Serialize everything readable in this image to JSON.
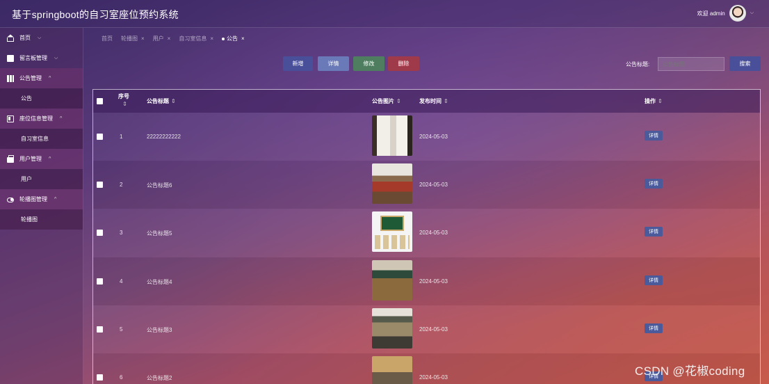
{
  "header": {
    "title": "基于springboot的自习室座位预约系统",
    "welcome": "欢迎 admin"
  },
  "sidebar": {
    "items": [
      {
        "label": "首页",
        "icon": "home-icon",
        "sub": []
      },
      {
        "label": "留言板管理",
        "icon": "message-icon",
        "sub": []
      },
      {
        "label": "公告管理",
        "icon": "chart-icon",
        "sub": [
          "公告"
        ]
      },
      {
        "label": "座位信息管理",
        "icon": "card-icon",
        "sub": [
          "自习室信息"
        ]
      },
      {
        "label": "用户管理",
        "icon": "user-icon",
        "sub": [
          "用户"
        ]
      },
      {
        "label": "轮播图管理",
        "icon": "toggle-icon",
        "sub": [
          "轮播图"
        ]
      }
    ]
  },
  "tabs": [
    "首页",
    "轮播图",
    "用户",
    "自习室信息",
    "公告"
  ],
  "toolbar": {
    "add": "新增",
    "detail": "详情",
    "edit": "修改",
    "delete": "删除",
    "search_label": "公告标题:",
    "search_placeholder": "公告标题",
    "search": "搜索"
  },
  "table": {
    "headers": {
      "no": "序号",
      "title": "公告标题",
      "image": "公告图片",
      "time": "发布时间",
      "op": "操作"
    },
    "rows": [
      {
        "no": "1",
        "title": "22222222222",
        "time": "2024-05-03",
        "op": "详情"
      },
      {
        "no": "2",
        "title": "公告标题6",
        "time": "2024-05-03",
        "op": "详情"
      },
      {
        "no": "3",
        "title": "公告标题5",
        "time": "2024-05-03",
        "op": "详情"
      },
      {
        "no": "4",
        "title": "公告标题4",
        "time": "2024-05-03",
        "op": "详情"
      },
      {
        "no": "5",
        "title": "公告标题3",
        "time": "2024-05-03",
        "op": "详情"
      },
      {
        "no": "6",
        "title": "公告标题2",
        "time": "2024-05-03",
        "op": "详情"
      }
    ]
  },
  "watermark": "CSDN @花椒coding"
}
